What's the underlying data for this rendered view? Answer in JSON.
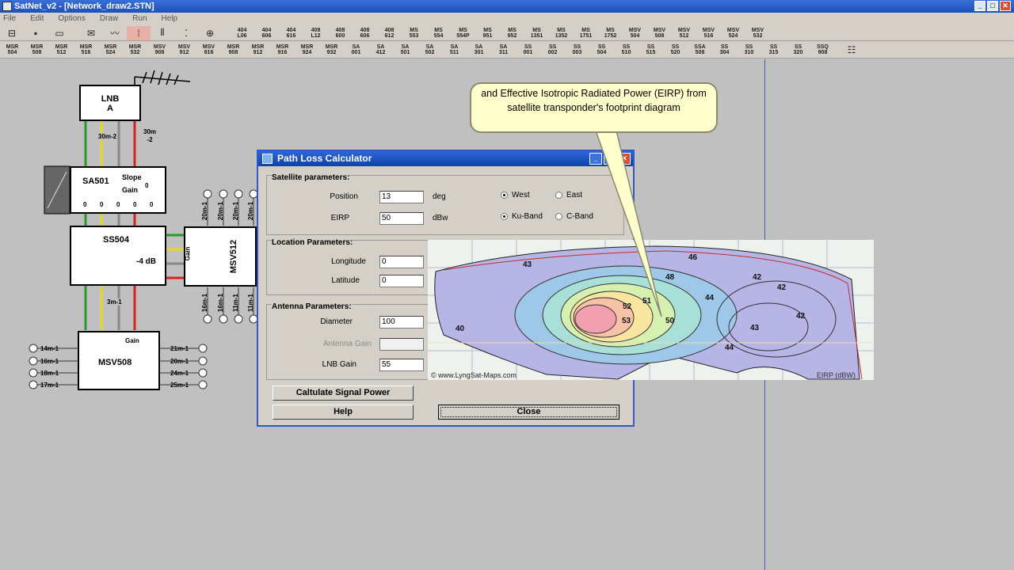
{
  "window": {
    "title": "SatNet_v2 - [Network_draw2.STN]"
  },
  "menu": [
    "File",
    "Edit",
    "Options",
    "Draw",
    "Run",
    "Help"
  ],
  "toolbar1": {
    "tools": [
      "open-icon",
      "save-icon",
      "print-icon",
      "cut-icon",
      "wire-icon",
      "select-icon",
      "column-icon",
      "points-icon",
      "target-icon"
    ],
    "buttons": [
      "404\nL06",
      "404\n606",
      "404\n616",
      "408\nL12",
      "408\n600",
      "408\n606",
      "408\n612",
      "MS\n553",
      "MS\n554",
      "MS\n554P",
      "MS\n951",
      "MS\n952",
      "MS\n1351",
      "MS\n1352",
      "MS\n1751",
      "MS\n1752",
      "MSV\n504",
      "MSV\n508",
      "MSV\n512",
      "MSV\n516",
      "MSV\n524",
      "MSV\n532"
    ]
  },
  "toolbar2": {
    "buttons": [
      "MSR\n504",
      "MSR\n508",
      "MSR\n512",
      "MSR\n516",
      "MSR\n524",
      "MSR\n532",
      "MSV\n908",
      "MSV\n912",
      "MSV\n916",
      "MSR\n908",
      "MSR\n912",
      "MSR\n916",
      "MSR\n924",
      "MSR\n932",
      "SA\n001",
      "SA\n412",
      "SA\n501",
      "SA\n502",
      "SA\n511",
      "SA\n301",
      "SA\n311",
      "SS\n001",
      "SS\n002",
      "SS\n003",
      "SS\n504",
      "SS\n510",
      "SS\n515",
      "SS\n520",
      "SSA\n508",
      "SS\n304",
      "SS\n310",
      "SS\n315",
      "SS\n320",
      "SSQ\n908"
    ]
  },
  "diagram": {
    "lnb": {
      "line1": "LNB",
      "line2": "A"
    },
    "cable1": "30m-2",
    "cable2": "30m\n-2",
    "sa501": "SA501",
    "slope": "Slope",
    "gain": "Gain",
    "zero": "0",
    "ss504": "SS504",
    "ss504_gain": "-4 dB",
    "cable3": "3m-1",
    "msv512": "MSV512",
    "msv512_gain": "Gain",
    "msv508": "MSV508",
    "msv508_gain": "Gain",
    "top_cables": [
      "20m-1",
      "20m-1",
      "20m-1",
      "20m-1"
    ],
    "bottom_cables": [
      "16m-1",
      "16m-1",
      "11m-1",
      "11m-1"
    ],
    "left_cables": [
      "14m-1",
      "16m-1",
      "18m-1",
      "17m-1"
    ],
    "right_cables": [
      "21m-1",
      "20m-1",
      "24m-1",
      "25m-1"
    ]
  },
  "callout": {
    "text": "and  Effective Isotropic Radiated Power (EIRP) from satellite transponder's footprint diagram"
  },
  "dialog": {
    "title": "Path Loss Calculator",
    "satellite": {
      "heading": "Satellite parameters:",
      "position_label": "Position",
      "position_value": "13",
      "position_unit": "deg",
      "eirp_label": "EIRP",
      "eirp_value": "50",
      "eirp_unit": "dBw",
      "west": "West",
      "east": "East",
      "ku": "Ku-Band",
      "c": "C-Band"
    },
    "location": {
      "heading": "Location Parameters:",
      "longitude_label": "Longitude",
      "longitude_value": "0",
      "latitude_label": "Latitude",
      "latitude_value": "0"
    },
    "antenna": {
      "heading": "Antenna Parameters:",
      "diameter_label": "Diameter",
      "diameter_value": "100",
      "gain_label": "Antenna Gain",
      "gain_value": "",
      "lnb_label": "LNB Gain",
      "lnb_value": "55"
    },
    "calc_button": "Caltulate Signal Power",
    "help_button": "Help",
    "close_button": "Close"
  },
  "map": {
    "credit": "© www.LyngSat-Maps.com",
    "unit_label": "EIRP (dBW)",
    "contours": [
      "43",
      "46",
      "48",
      "42",
      "42",
      "51",
      "52",
      "44",
      "53",
      "50",
      "40",
      "43",
      "42",
      "44"
    ]
  }
}
